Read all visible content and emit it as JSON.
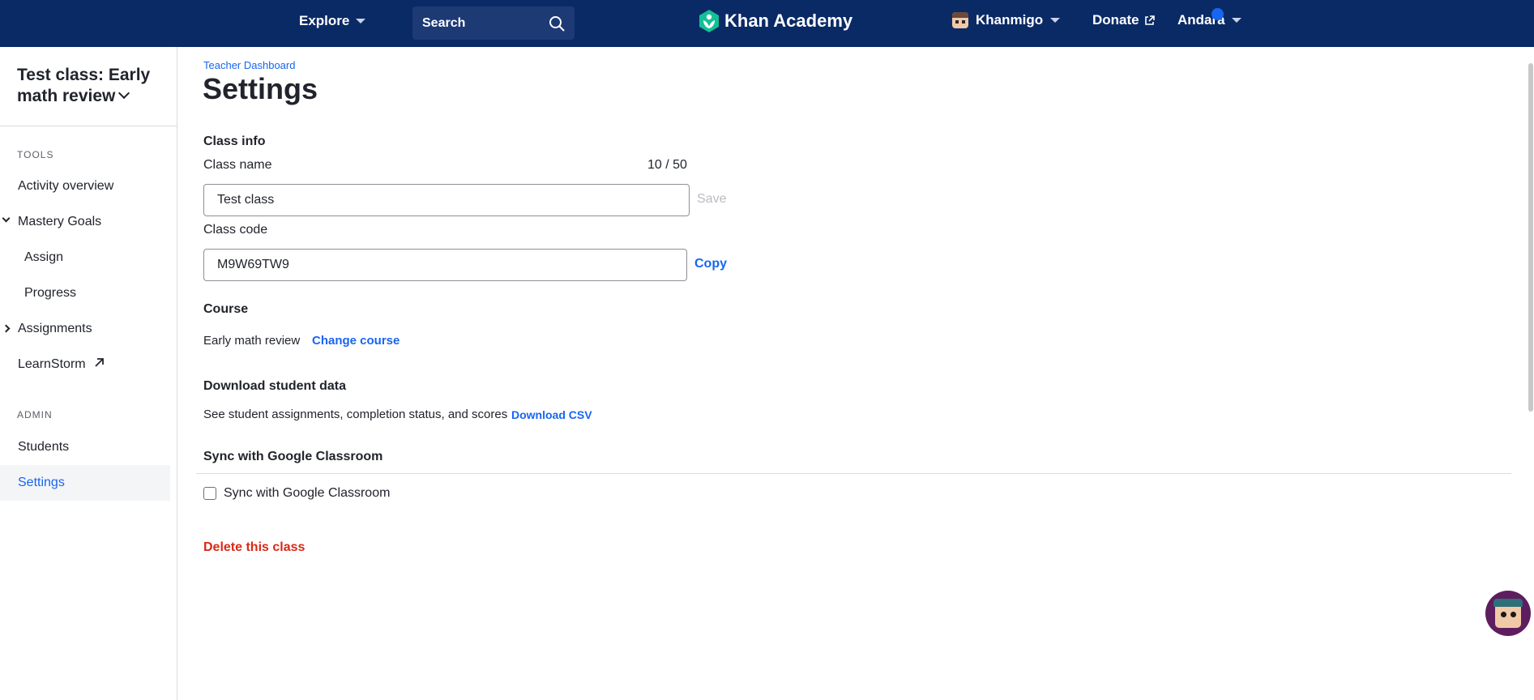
{
  "nav": {
    "explore": "Explore",
    "search_placeholder": "Search",
    "logo": "Khan Academy",
    "khanmigo": "Khanmigo",
    "donate": "Donate",
    "user": "Andara"
  },
  "sidebar": {
    "class_title": "Test class: Early math review",
    "tools_heading": "TOOLS",
    "admin_heading": "ADMIN",
    "items": {
      "activity_overview": "Activity overview",
      "mastery_goals": "Mastery Goals",
      "assign": "Assign",
      "progress": "Progress",
      "assignments": "Assignments",
      "learnstorm": "LearnStorm",
      "students": "Students",
      "settings": "Settings"
    }
  },
  "main": {
    "breadcrumb": "Teacher Dashboard",
    "title": "Settings",
    "class_info": {
      "heading": "Class info",
      "class_name_label": "Class name",
      "class_name_counter": "10 / 50",
      "class_name_value": "Test class",
      "save": "Save",
      "class_code_label": "Class code",
      "class_code_value": "M9W69TW9",
      "copy": "Copy"
    },
    "course": {
      "heading": "Course",
      "value": "Early math review",
      "change": "Change course"
    },
    "download": {
      "heading": "Download student data",
      "description": "See student assignments, completion status, and scores",
      "button": "Download CSV"
    },
    "sync": {
      "heading": "Sync with Google Classroom",
      "checkbox_label": "Sync with Google Classroom",
      "checked": false
    },
    "delete": "Delete this class"
  },
  "colors": {
    "nav_bg": "#0a2a66",
    "link": "#1865f2",
    "danger": "#d92916",
    "logo_green": "#14bf96"
  }
}
